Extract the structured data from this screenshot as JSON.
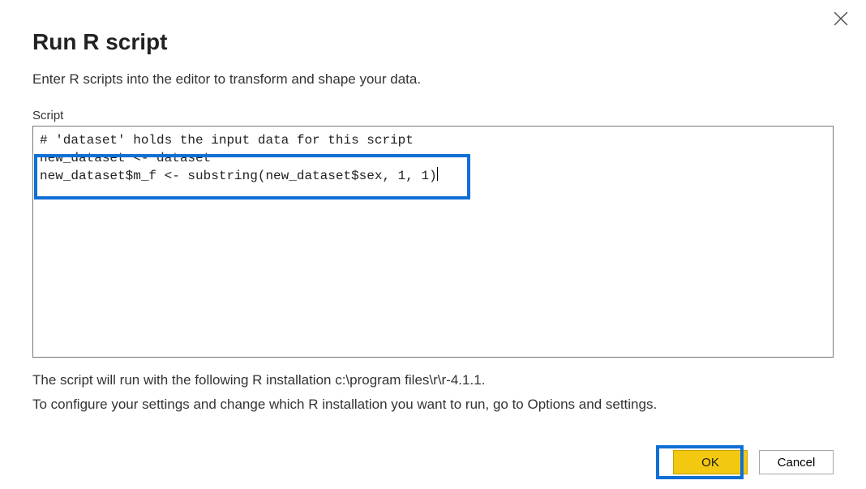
{
  "dialog": {
    "title": "Run R script",
    "subtitle": "Enter R scripts into the editor to transform and shape your data.",
    "scriptFieldLabel": "Script",
    "scriptLines": {
      "l1": "# 'dataset' holds the input data for this script",
      "l2": "new_dataset <- dataset",
      "l3": "new_dataset$m_f <- substring(new_dataset$sex, 1, 1)"
    },
    "info1": "The script will run with the following R installation c:\\program files\\r\\r-4.1.1.",
    "info2": "To configure your settings and change which R installation you want to run, go to Options and settings.",
    "okLabel": "OK",
    "cancelLabel": "Cancel"
  }
}
